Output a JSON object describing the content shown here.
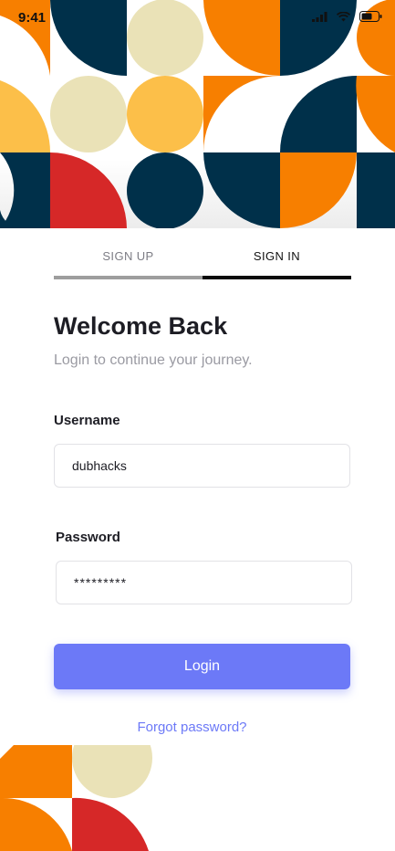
{
  "status_bar": {
    "time": "9:41"
  },
  "tabs": [
    {
      "label": "SIGN UP",
      "active": false
    },
    {
      "label": "SIGN IN",
      "active": true
    }
  ],
  "heading": "Welcome Back",
  "subheading": "Login to continue your journey.",
  "username": {
    "label": "Username",
    "value": "dubhacks"
  },
  "password": {
    "label": "Password",
    "value": "*********"
  },
  "login_button": "Login",
  "forgot_link": "Forgot password?",
  "colors": {
    "navy": "#00304a",
    "orange": "#f77f00",
    "yellow": "#fcbf49",
    "cream": "#eae2b7",
    "red": "#d62828",
    "accent": "#6c79f7"
  },
  "icons": [
    "signal-icon",
    "wifi-icon",
    "battery-icon"
  ]
}
